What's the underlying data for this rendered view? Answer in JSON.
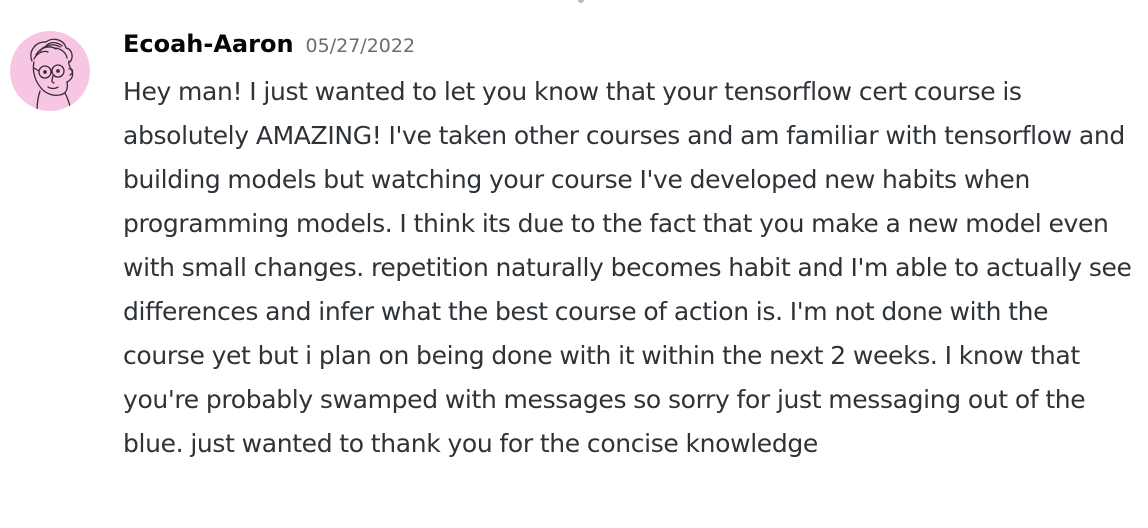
{
  "message": {
    "author": "Ecoah-Aaron",
    "timestamp": "05/27/2022",
    "avatar_icon": "doodle-face-avatar-icon",
    "avatar_background": "#f7c6e3",
    "text": "Hey man! I just wanted to let you know that your tensorflow cert course is absolutely AMAZING! I've taken other courses and am familiar with tensorflow and building models but watching your course I've developed new habits when programming models. I think its due to the fact that you make a new model even with small changes. repetition naturally becomes habit and I'm able to actually see differences and infer what the best course of action is. I'm not done with the course yet but i plan on being done with it within the next 2 weeks. I know that you're probably swamped with messages so sorry for just messaging out of the blue. just wanted to thank you for the concise knowledge"
  },
  "colors": {
    "username": "#060607",
    "timestamp": "#6a6e74",
    "text": "#2e3338",
    "background": "#ffffff"
  }
}
